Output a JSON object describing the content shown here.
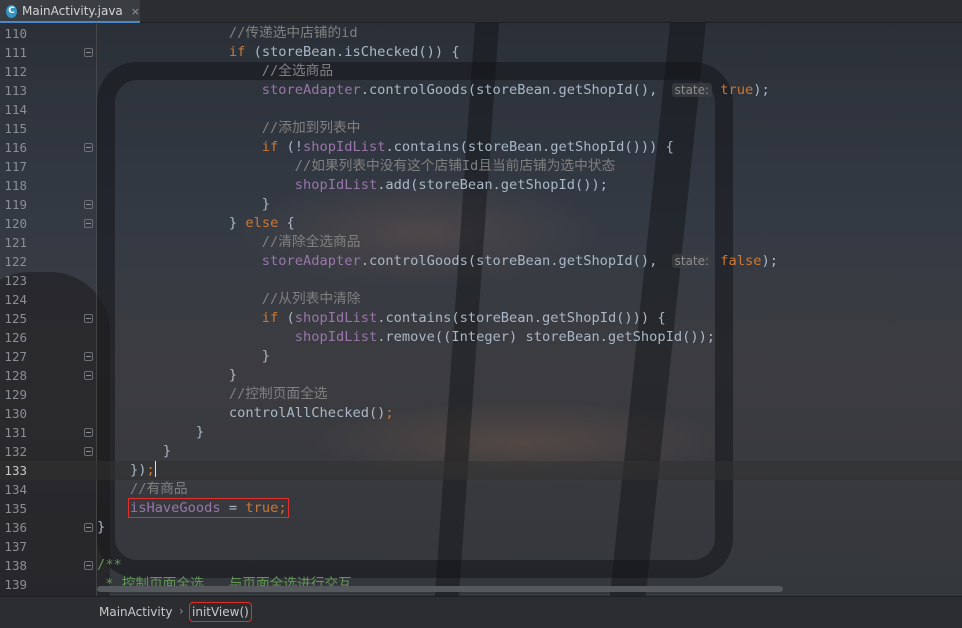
{
  "tab": {
    "icon": "C",
    "title": "MainActivity.java",
    "close": "×"
  },
  "lines": [
    {
      "n": "110",
      "segs": [
        [
          "cm",
          "                //传递选中店铺的id"
        ]
      ]
    },
    {
      "n": "111",
      "fold": true,
      "segs": [
        [
          "kw",
          "                if "
        ],
        [
          "fn",
          "(storeBean.isChecked()) {"
        ]
      ]
    },
    {
      "n": "112",
      "segs": [
        [
          "cm",
          "                    //全选商品"
        ]
      ]
    },
    {
      "n": "113",
      "segs": [
        [
          "fld",
          "                    storeAdapter"
        ],
        [
          "fn",
          ".controlGoods(storeBean.getShopId(), "
        ],
        [
          "hint",
          "state:"
        ],
        [
          "kw",
          " true"
        ],
        [
          "fn",
          ");"
        ]
      ]
    },
    {
      "n": "114",
      "segs": []
    },
    {
      "n": "115",
      "segs": [
        [
          "cm",
          "                    //添加到列表中"
        ]
      ]
    },
    {
      "n": "116",
      "fold": true,
      "segs": [
        [
          "kw",
          "                    if "
        ],
        [
          "fn",
          "(!"
        ],
        [
          "fld",
          "shopIdList"
        ],
        [
          "fn",
          ".contains(storeBean.getShopId())) {"
        ]
      ]
    },
    {
      "n": "117",
      "segs": [
        [
          "cm",
          "                        //如果列表中没有这个店铺Id且当前店铺为选中状态"
        ]
      ]
    },
    {
      "n": "118",
      "segs": [
        [
          "fld",
          "                        shopIdList"
        ],
        [
          "fn",
          ".add(storeBean.getShopId());"
        ]
      ]
    },
    {
      "n": "119",
      "fold": true,
      "segs": [
        [
          "fn",
          "                    }"
        ]
      ]
    },
    {
      "n": "120",
      "fold": true,
      "segs": [
        [
          "fn",
          "                } "
        ],
        [
          "kw",
          "else"
        ],
        [
          "fn",
          " {"
        ]
      ]
    },
    {
      "n": "121",
      "segs": [
        [
          "cm",
          "                    //清除全选商品"
        ]
      ]
    },
    {
      "n": "122",
      "segs": [
        [
          "fld",
          "                    storeAdapter"
        ],
        [
          "fn",
          ".controlGoods(storeBean.getShopId(), "
        ],
        [
          "hint",
          "state:"
        ],
        [
          "kw",
          " false"
        ],
        [
          "fn",
          ");"
        ]
      ]
    },
    {
      "n": "123",
      "segs": []
    },
    {
      "n": "124",
      "segs": [
        [
          "cm",
          "                    //从列表中清除"
        ]
      ]
    },
    {
      "n": "125",
      "fold": true,
      "segs": [
        [
          "kw",
          "                    if "
        ],
        [
          "fn",
          "("
        ],
        [
          "fld",
          "shopIdList"
        ],
        [
          "fn",
          ".contains(storeBean.getShopId())) {"
        ]
      ]
    },
    {
      "n": "126",
      "segs": [
        [
          "fld",
          "                        shopIdList"
        ],
        [
          "fn",
          ".remove((Integer) storeBean.getShopId());"
        ]
      ]
    },
    {
      "n": "127",
      "fold": true,
      "segs": [
        [
          "fn",
          "                    }"
        ]
      ]
    },
    {
      "n": "128",
      "fold": true,
      "segs": [
        [
          "fn",
          "                }"
        ]
      ]
    },
    {
      "n": "129",
      "segs": [
        [
          "cm",
          "                //控制页面全选"
        ]
      ]
    },
    {
      "n": "130",
      "segs": [
        [
          "fn",
          "                controlAllChecked()"
        ],
        [
          "kw",
          ";"
        ]
      ]
    },
    {
      "n": "131",
      "fold": true,
      "segs": [
        [
          "fn",
          "            }"
        ]
      ]
    },
    {
      "n": "132",
      "fold": true,
      "segs": [
        [
          "fn",
          "        }"
        ]
      ]
    },
    {
      "n": "133",
      "current": true,
      "segs": [
        [
          "fn",
          "    })"
        ],
        [
          "kw",
          ";"
        ],
        [
          "caret",
          ""
        ]
      ]
    },
    {
      "n": "134",
      "segs": [
        [
          "cm",
          "    //有商品"
        ]
      ]
    },
    {
      "n": "135",
      "segs": [
        [
          "fn",
          "    "
        ],
        [
          "box-start",
          ""
        ],
        [
          "fld",
          "isHaveGoods"
        ],
        [
          "fn",
          " = "
        ],
        [
          "kw",
          "true;"
        ],
        [
          "box-end",
          ""
        ]
      ]
    },
    {
      "n": "136",
      "fold": true,
      "segs": [
        [
          "fn",
          "}"
        ]
      ]
    },
    {
      "n": "137",
      "segs": []
    },
    {
      "n": "138",
      "fold": true,
      "segs": [
        [
          "dc",
          "/**"
        ]
      ]
    },
    {
      "n": "139",
      "segs": [
        [
          "dc",
          " * 控制页面全选   与页面全选进行交互"
        ]
      ]
    }
  ],
  "breadcrumb": {
    "class_name": "MainActivity",
    "separator": "›",
    "method": "initView()"
  }
}
